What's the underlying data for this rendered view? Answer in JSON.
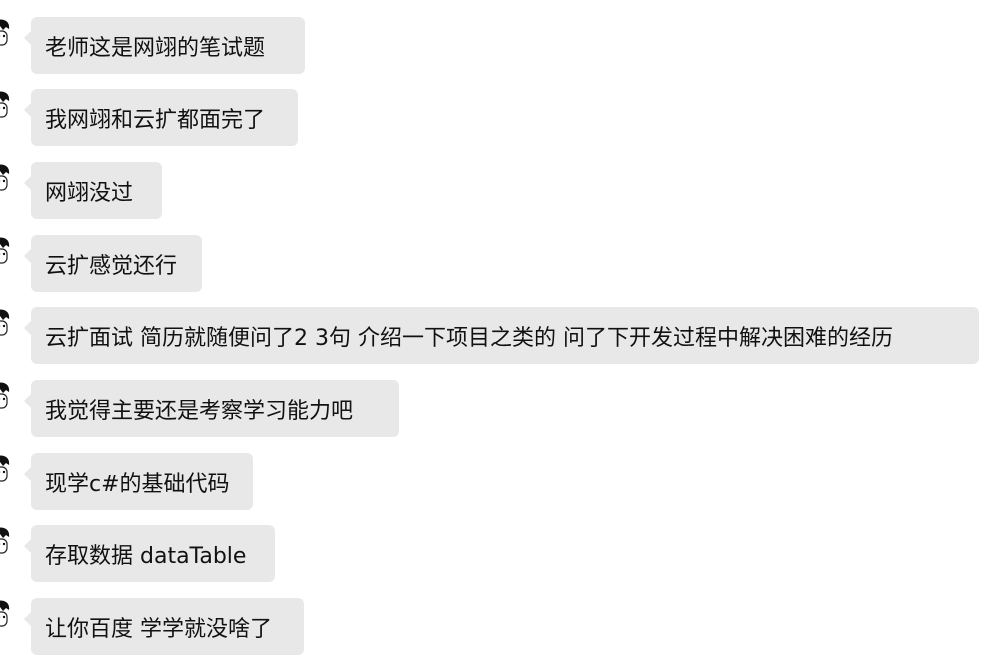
{
  "messages": [
    {
      "text": "老师这是网翊的笔试题"
    },
    {
      "text": "我网翊和云扩都面完了"
    },
    {
      "text": "网翊没过"
    },
    {
      "text": "云扩感觉还行"
    },
    {
      "text": "云扩面试 简历就随便问了2 3句 介绍一下项目之类的 问了下开发过程中解决困难的经历"
    },
    {
      "text": "我觉得主要还是考察学习能力吧"
    },
    {
      "text": "现学c#的基础代码"
    },
    {
      "text": "存取数据 dataTable"
    },
    {
      "text": "让你百度 学学就没啥了"
    }
  ],
  "colors": {
    "bubble": "#e8e8e8",
    "text": "#111111",
    "background": "#ffffff"
  }
}
